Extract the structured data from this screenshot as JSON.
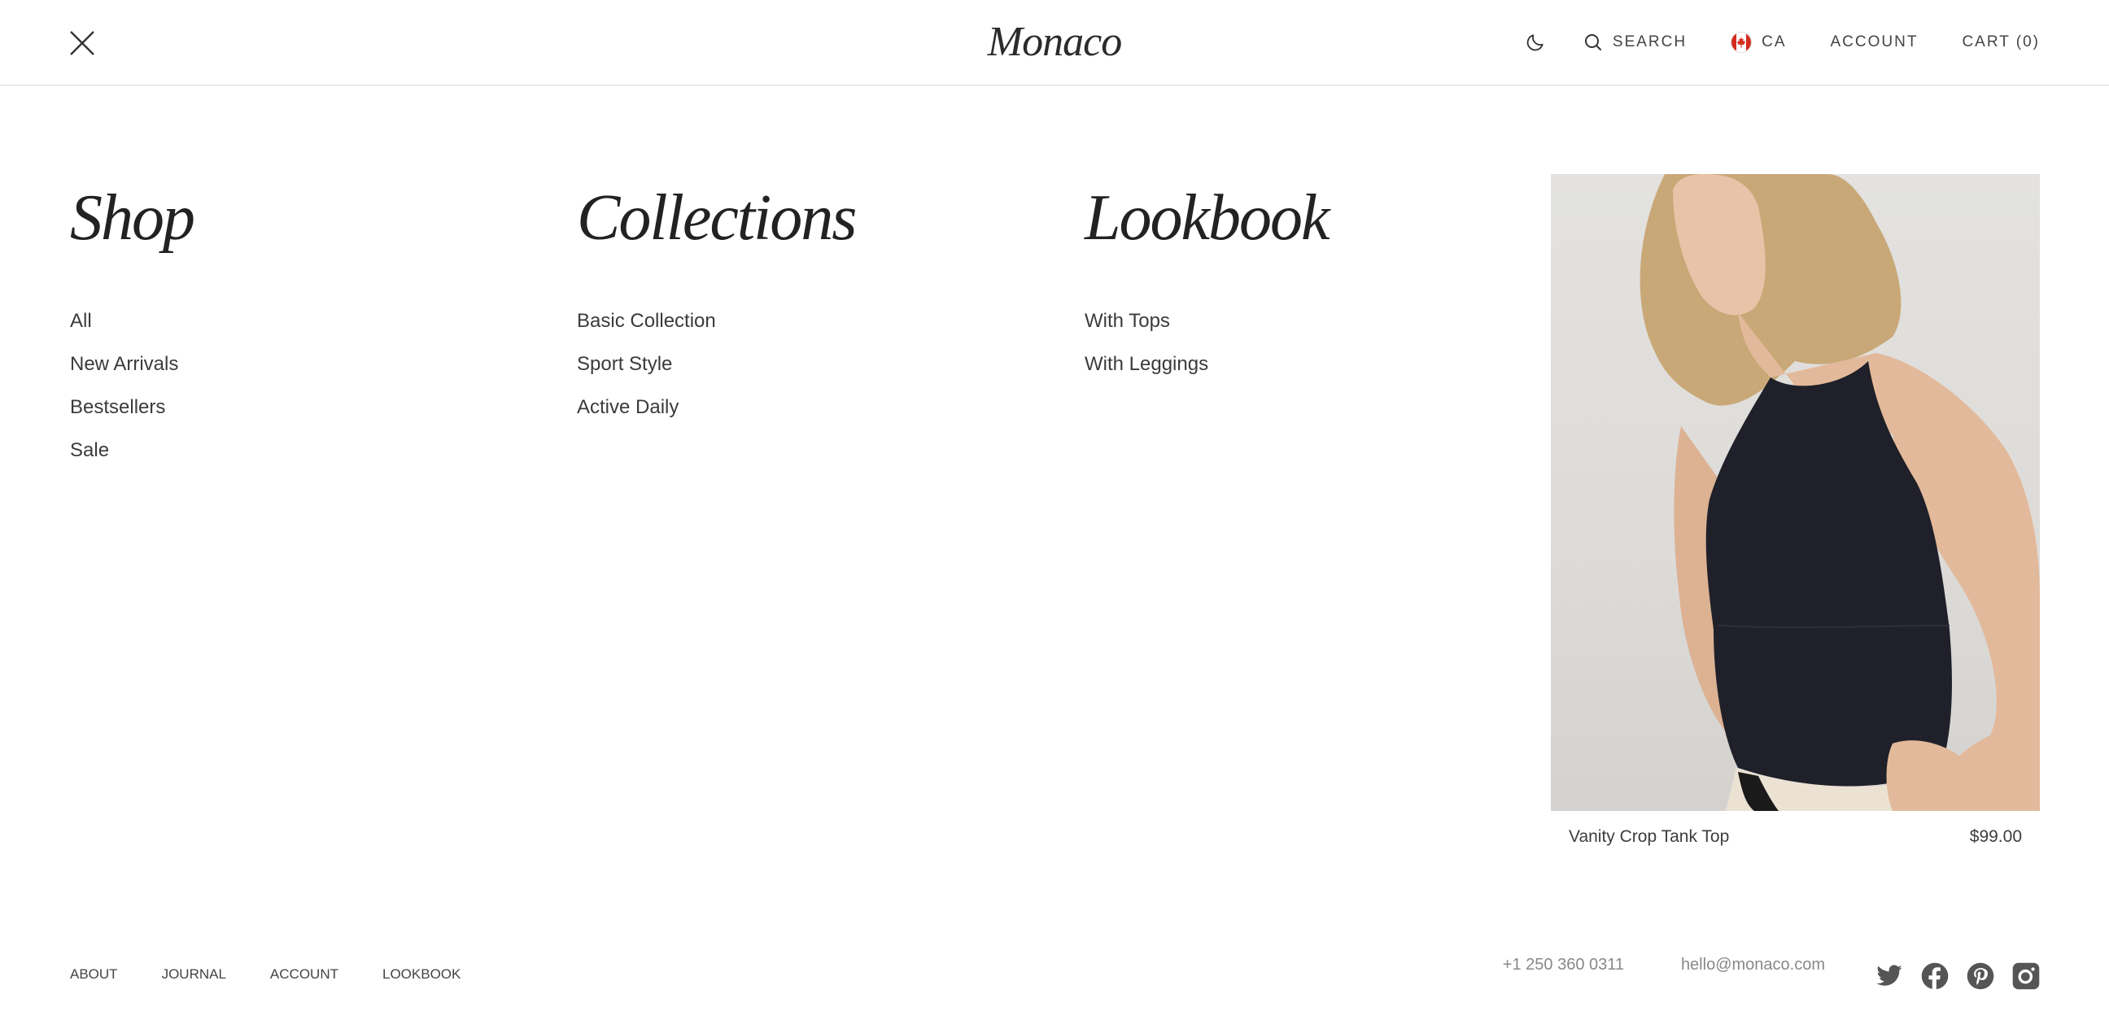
{
  "header": {
    "logo": "Monaco",
    "close_icon": "close-icon",
    "theme_icon": "moon-icon",
    "search_icon": "search-icon",
    "search_label": "SEARCH",
    "region_flag": "canada-flag-icon",
    "region_label": "CA",
    "account_label": "ACCOUNT",
    "cart_label": "CART (0)"
  },
  "menu": {
    "columns": [
      {
        "heading": "Shop",
        "links": [
          "All",
          "New Arrivals",
          "Bestsellers",
          "Sale"
        ]
      },
      {
        "heading": "Collections",
        "links": [
          "Basic Collection",
          "Sport Style",
          "Active Daily"
        ]
      },
      {
        "heading": "Lookbook",
        "links": [
          "With Tops",
          "With Leggings"
        ]
      }
    ]
  },
  "featured_product": {
    "name": "Vanity Crop Tank Top",
    "price": "$99.00",
    "image_description": "Model wearing black crop tank top"
  },
  "footer": {
    "links": [
      "ABOUT",
      "JOURNAL",
      "ACCOUNT",
      "LOOKBOOK"
    ],
    "phone": "+1 250 360 0311",
    "email": "hello@monaco.com",
    "socials": [
      "twitter-icon",
      "facebook-icon",
      "pinterest-icon",
      "instagram-icon"
    ]
  },
  "colors": {
    "text": "#333333",
    "muted": "#888888",
    "border": "#e9e9e9",
    "flag_red": "#d52b1e"
  }
}
